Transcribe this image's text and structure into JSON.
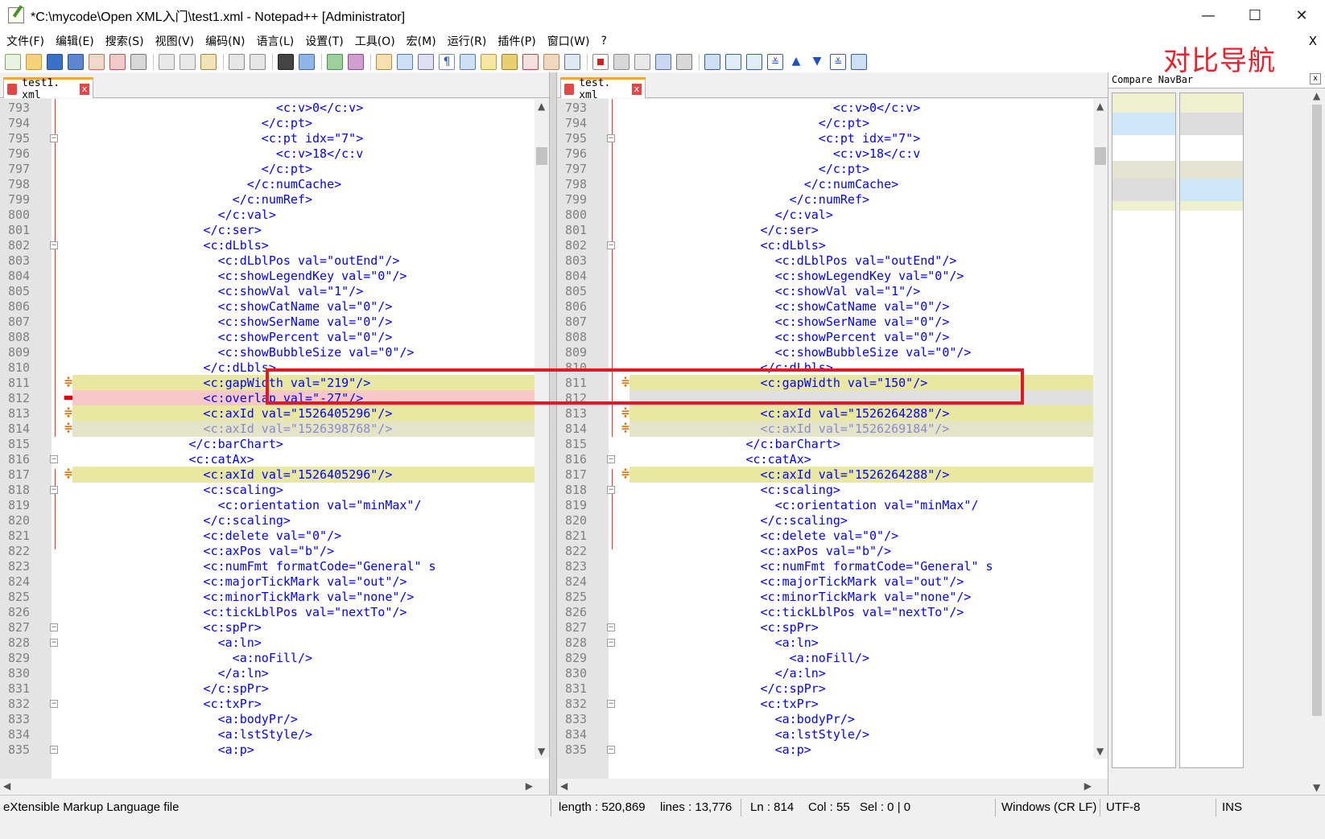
{
  "window": {
    "title": "*C:\\mycode\\Open XML入门\\test1.xml - Notepad++ [Administrator]",
    "minimize": "—",
    "maximize": "☐",
    "close": "✕"
  },
  "menu": {
    "items": [
      "文件(F)",
      "编辑(E)",
      "搜索(S)",
      "视图(V)",
      "编码(N)",
      "语言(L)",
      "设置(T)",
      "工具(O)",
      "宏(M)",
      "运行(R)",
      "插件(P)",
      "窗口(W)",
      "?"
    ],
    "close_glyph": "X"
  },
  "annotation": {
    "nav_label": "对比导航",
    "color": "#e8212c"
  },
  "left_tab": {
    "label": "test1. xml",
    "close": "x"
  },
  "right_tab": {
    "label": "test. xml",
    "close": "x"
  },
  "navbar": {
    "title": "Compare NavBar",
    "close": "x"
  },
  "left_lines": [
    {
      "n": "793",
      "code": "                            <c:v>0</c:v>",
      "state": ""
    },
    {
      "n": "794",
      "code": "                          </c:pt>",
      "state": ""
    },
    {
      "n": "795",
      "code": "                          <c:pt idx=\"7\">",
      "state": "",
      "fold": true
    },
    {
      "n": "796",
      "code": "                            <c:v>18</c:v",
      "state": ""
    },
    {
      "n": "797",
      "code": "                          </c:pt>",
      "state": ""
    },
    {
      "n": "798",
      "code": "                        </c:numCache>",
      "state": ""
    },
    {
      "n": "799",
      "code": "                      </c:numRef>",
      "state": ""
    },
    {
      "n": "800",
      "code": "                    </c:val>",
      "state": ""
    },
    {
      "n": "801",
      "code": "                  </c:ser>",
      "state": ""
    },
    {
      "n": "802",
      "code": "                  <c:dLbls>",
      "state": "",
      "fold": true
    },
    {
      "n": "803",
      "code": "                    <c:dLblPos val=\"outEnd\"/>",
      "state": ""
    },
    {
      "n": "804",
      "code": "                    <c:showLegendKey val=\"0\"/>",
      "state": ""
    },
    {
      "n": "805",
      "code": "                    <c:showVal val=\"1\"/>",
      "state": ""
    },
    {
      "n": "806",
      "code": "                    <c:showCatName val=\"0\"/>",
      "state": ""
    },
    {
      "n": "807",
      "code": "                    <c:showSerName val=\"0\"/>",
      "state": ""
    },
    {
      "n": "808",
      "code": "                    <c:showPercent val=\"0\"/>",
      "state": ""
    },
    {
      "n": "809",
      "code": "                    <c:showBubbleSize val=\"0\"/>",
      "state": ""
    },
    {
      "n": "810",
      "code": "                  </c:dLbls>",
      "state": ""
    },
    {
      "n": "811",
      "code": "                  <c:gapWidth val=\"219\"/>",
      "state": "changed",
      "mark": "plus"
    },
    {
      "n": "812",
      "code": "                  <c:overlap val=\"-27\"/>",
      "state": "removed",
      "mark": "minus"
    },
    {
      "n": "813",
      "code": "                  <c:axId val=\"1526405296\"/>",
      "state": "changed",
      "mark": "plus"
    },
    {
      "n": "814",
      "code": "                  <c:axId val=\"1526398768\"/>",
      "state": "moved",
      "mark": "plus"
    },
    {
      "n": "815",
      "code": "                </c:barChart>",
      "state": ""
    },
    {
      "n": "816",
      "code": "                <c:catAx>",
      "state": "",
      "fold": true
    },
    {
      "n": "817",
      "code": "                  <c:axId val=\"1526405296\"/>",
      "state": "changed",
      "mark": "plus"
    },
    {
      "n": "818",
      "code": "                  <c:scaling>",
      "state": "",
      "fold": true
    },
    {
      "n": "819",
      "code": "                    <c:orientation val=\"minMax\"/",
      "state": ""
    },
    {
      "n": "820",
      "code": "                  </c:scaling>",
      "state": ""
    },
    {
      "n": "821",
      "code": "                  <c:delete val=\"0\"/>",
      "state": ""
    },
    {
      "n": "822",
      "code": "                  <c:axPos val=\"b\"/>",
      "state": ""
    },
    {
      "n": "823",
      "code": "                  <c:numFmt formatCode=\"General\" s",
      "state": ""
    },
    {
      "n": "824",
      "code": "                  <c:majorTickMark val=\"out\"/>",
      "state": ""
    },
    {
      "n": "825",
      "code": "                  <c:minorTickMark val=\"none\"/>",
      "state": ""
    },
    {
      "n": "826",
      "code": "                  <c:tickLblPos val=\"nextTo\"/>",
      "state": ""
    },
    {
      "n": "827",
      "code": "                  <c:spPr>",
      "state": "",
      "fold": true
    },
    {
      "n": "828",
      "code": "                    <a:ln>",
      "state": "",
      "fold": true
    },
    {
      "n": "829",
      "code": "                      <a:noFill/>",
      "state": ""
    },
    {
      "n": "830",
      "code": "                    </a:ln>",
      "state": ""
    },
    {
      "n": "831",
      "code": "                  </c:spPr>",
      "state": ""
    },
    {
      "n": "832",
      "code": "                  <c:txPr>",
      "state": "",
      "fold": true
    },
    {
      "n": "833",
      "code": "                    <a:bodyPr/>",
      "state": ""
    },
    {
      "n": "834",
      "code": "                    <a:lstStyle/>",
      "state": ""
    },
    {
      "n": "835",
      "code": "                    <a:p>",
      "state": "",
      "fold": true
    }
  ],
  "right_lines": [
    {
      "n": "793",
      "code": "                            <c:v>0</c:v>",
      "state": ""
    },
    {
      "n": "794",
      "code": "                          </c:pt>",
      "state": ""
    },
    {
      "n": "795",
      "code": "                          <c:pt idx=\"7\">",
      "state": "",
      "fold": true
    },
    {
      "n": "796",
      "code": "                            <c:v>18</c:v",
      "state": ""
    },
    {
      "n": "797",
      "code": "                          </c:pt>",
      "state": ""
    },
    {
      "n": "798",
      "code": "                        </c:numCache>",
      "state": ""
    },
    {
      "n": "799",
      "code": "                      </c:numRef>",
      "state": ""
    },
    {
      "n": "800",
      "code": "                    </c:val>",
      "state": ""
    },
    {
      "n": "801",
      "code": "                  </c:ser>",
      "state": ""
    },
    {
      "n": "802",
      "code": "                  <c:dLbls>",
      "state": "",
      "fold": true
    },
    {
      "n": "803",
      "code": "                    <c:dLblPos val=\"outEnd\"/>",
      "state": ""
    },
    {
      "n": "804",
      "code": "                    <c:showLegendKey val=\"0\"/>",
      "state": ""
    },
    {
      "n": "805",
      "code": "                    <c:showVal val=\"1\"/>",
      "state": ""
    },
    {
      "n": "806",
      "code": "                    <c:showCatName val=\"0\"/>",
      "state": ""
    },
    {
      "n": "807",
      "code": "                    <c:showSerName val=\"0\"/>",
      "state": ""
    },
    {
      "n": "808",
      "code": "                    <c:showPercent val=\"0\"/>",
      "state": ""
    },
    {
      "n": "809",
      "code": "                    <c:showBubbleSize val=\"0\"/>",
      "state": ""
    },
    {
      "n": "810",
      "code": "                  </c:dLbls>",
      "state": ""
    },
    {
      "n": "811",
      "code": "                  <c:gapWidth val=\"150\"/>",
      "state": "changed",
      "mark": "plus"
    },
    {
      "n": "812",
      "code": "",
      "state": "blank"
    },
    {
      "n": "813",
      "code": "                  <c:axId val=\"1526264288\"/>",
      "state": "changed",
      "mark": "plus"
    },
    {
      "n": "814",
      "code": "                  <c:axId val=\"1526269184\"/>",
      "state": "moved",
      "mark": "plus"
    },
    {
      "n": "815",
      "code": "                </c:barChart>",
      "state": ""
    },
    {
      "n": "816",
      "code": "                <c:catAx>",
      "state": "",
      "fold": true
    },
    {
      "n": "817",
      "code": "                  <c:axId val=\"1526264288\"/>",
      "state": "changed",
      "mark": "plus"
    },
    {
      "n": "818",
      "code": "                  <c:scaling>",
      "state": "",
      "fold": true
    },
    {
      "n": "819",
      "code": "                    <c:orientation val=\"minMax\"/",
      "state": ""
    },
    {
      "n": "820",
      "code": "                  </c:scaling>",
      "state": ""
    },
    {
      "n": "821",
      "code": "                  <c:delete val=\"0\"/>",
      "state": ""
    },
    {
      "n": "822",
      "code": "                  <c:axPos val=\"b\"/>",
      "state": ""
    },
    {
      "n": "823",
      "code": "                  <c:numFmt formatCode=\"General\" s",
      "state": ""
    },
    {
      "n": "824",
      "code": "                  <c:majorTickMark val=\"out\"/>",
      "state": ""
    },
    {
      "n": "825",
      "code": "                  <c:minorTickMark val=\"none\"/>",
      "state": ""
    },
    {
      "n": "826",
      "code": "                  <c:tickLblPos val=\"nextTo\"/>",
      "state": ""
    },
    {
      "n": "827",
      "code": "                  <c:spPr>",
      "state": "",
      "fold": true
    },
    {
      "n": "828",
      "code": "                    <a:ln>",
      "state": "",
      "fold": true
    },
    {
      "n": "829",
      "code": "                      <a:noFill/>",
      "state": ""
    },
    {
      "n": "830",
      "code": "                    </a:ln>",
      "state": ""
    },
    {
      "n": "831",
      "code": "                  </c:spPr>",
      "state": ""
    },
    {
      "n": "832",
      "code": "                  <c:txPr>",
      "state": "",
      "fold": true
    },
    {
      "n": "833",
      "code": "                    <a:bodyPr/>",
      "state": ""
    },
    {
      "n": "834",
      "code": "                    <a:lstStyle/>",
      "state": ""
    },
    {
      "n": "835",
      "code": "                    <a:p>",
      "state": "",
      "fold": true
    }
  ],
  "status": {
    "file_type": "eXtensible Markup Language file",
    "length": "length : 520,869",
    "lines": "lines : 13,776",
    "ln": "Ln : 814",
    "col": "Col : 55",
    "sel": "Sel : 0 | 0",
    "eol": "Windows (CR LF)",
    "encoding": "UTF-8",
    "mode": "INS"
  },
  "colors": {
    "changed": "#e8e8a0",
    "removed": "#f8c8c8",
    "blank": "#e0e0e0",
    "highlight_box": "#e01a25",
    "tab_accent": "#f4a53a"
  }
}
